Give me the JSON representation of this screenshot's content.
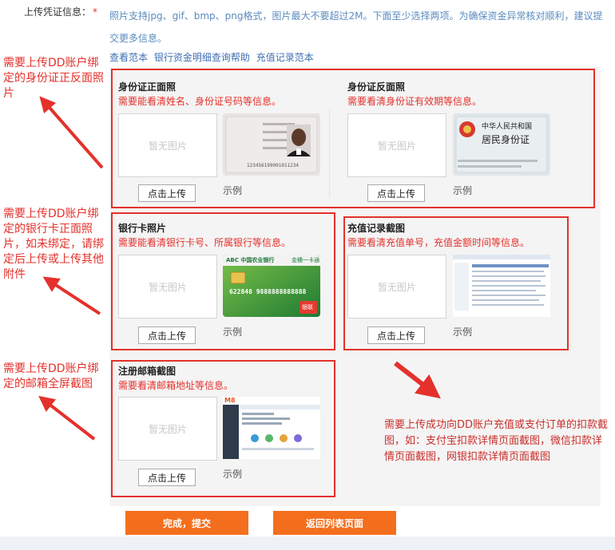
{
  "header": {
    "field_label": "上传凭证信息：",
    "required_mark": "*",
    "description": "照片支持jpg、gif、bmp、png格式，图片最大不要超过2M。下面至少选择两项。为确保资金异常核对顺利，建议提交更多信息。"
  },
  "links": [
    "查看范本",
    "银行资金明细查询帮助",
    "充值记录范本"
  ],
  "placeholder_text": "暂无图片",
  "upload_label": "点击上传",
  "example_label": "示例",
  "sections": {
    "id_front": {
      "title": "身份证正面照",
      "note": "需要能看清姓名、身份证号码等信息。"
    },
    "id_back": {
      "title": "身份证反面照",
      "note": "需要看清身份证有效期等信息。"
    },
    "bank_card": {
      "title": "银行卡照片",
      "note": "需要能看清银行卡号、所属银行等信息。"
    },
    "recharge": {
      "title": "充值记录截图",
      "note": "需要看清充值单号，充值金额时间等信息。"
    },
    "email": {
      "title": "注册邮箱截图",
      "note": "需要看清邮箱地址等信息。"
    }
  },
  "thumbs": {
    "id_back_title_1": "中华人民共和国",
    "id_back_title_2": "居民身份证",
    "bank_name": "ABC 中国农业银行",
    "bank_tag": "金穗一卡通",
    "card_number": "622848 9888888888888",
    "union_pay": "银联",
    "id_number": "123456199001011234",
    "email_logo": "M8"
  },
  "annotations": {
    "a1": "需要上传DD账户绑定的身份证正反面照片",
    "a2": "需要上传DD账户绑定的银行卡正面照片，如未绑定，请绑定后上传或上传其他附件",
    "a3": "需要上传DD账户绑定的邮箱全屏截图",
    "a4": "需要上传成功向DD账户充值或支付订单的扣款截图，如：支付宝扣款详情页面截图，微信扣款详情页面截图，网银扣款详情页面截图"
  },
  "buttons": {
    "submit": "完成，提交",
    "back": "返回列表页面"
  },
  "colors": {
    "red": "#e4312b",
    "orange": "#f46f1d",
    "link": "#3f6fb3"
  }
}
